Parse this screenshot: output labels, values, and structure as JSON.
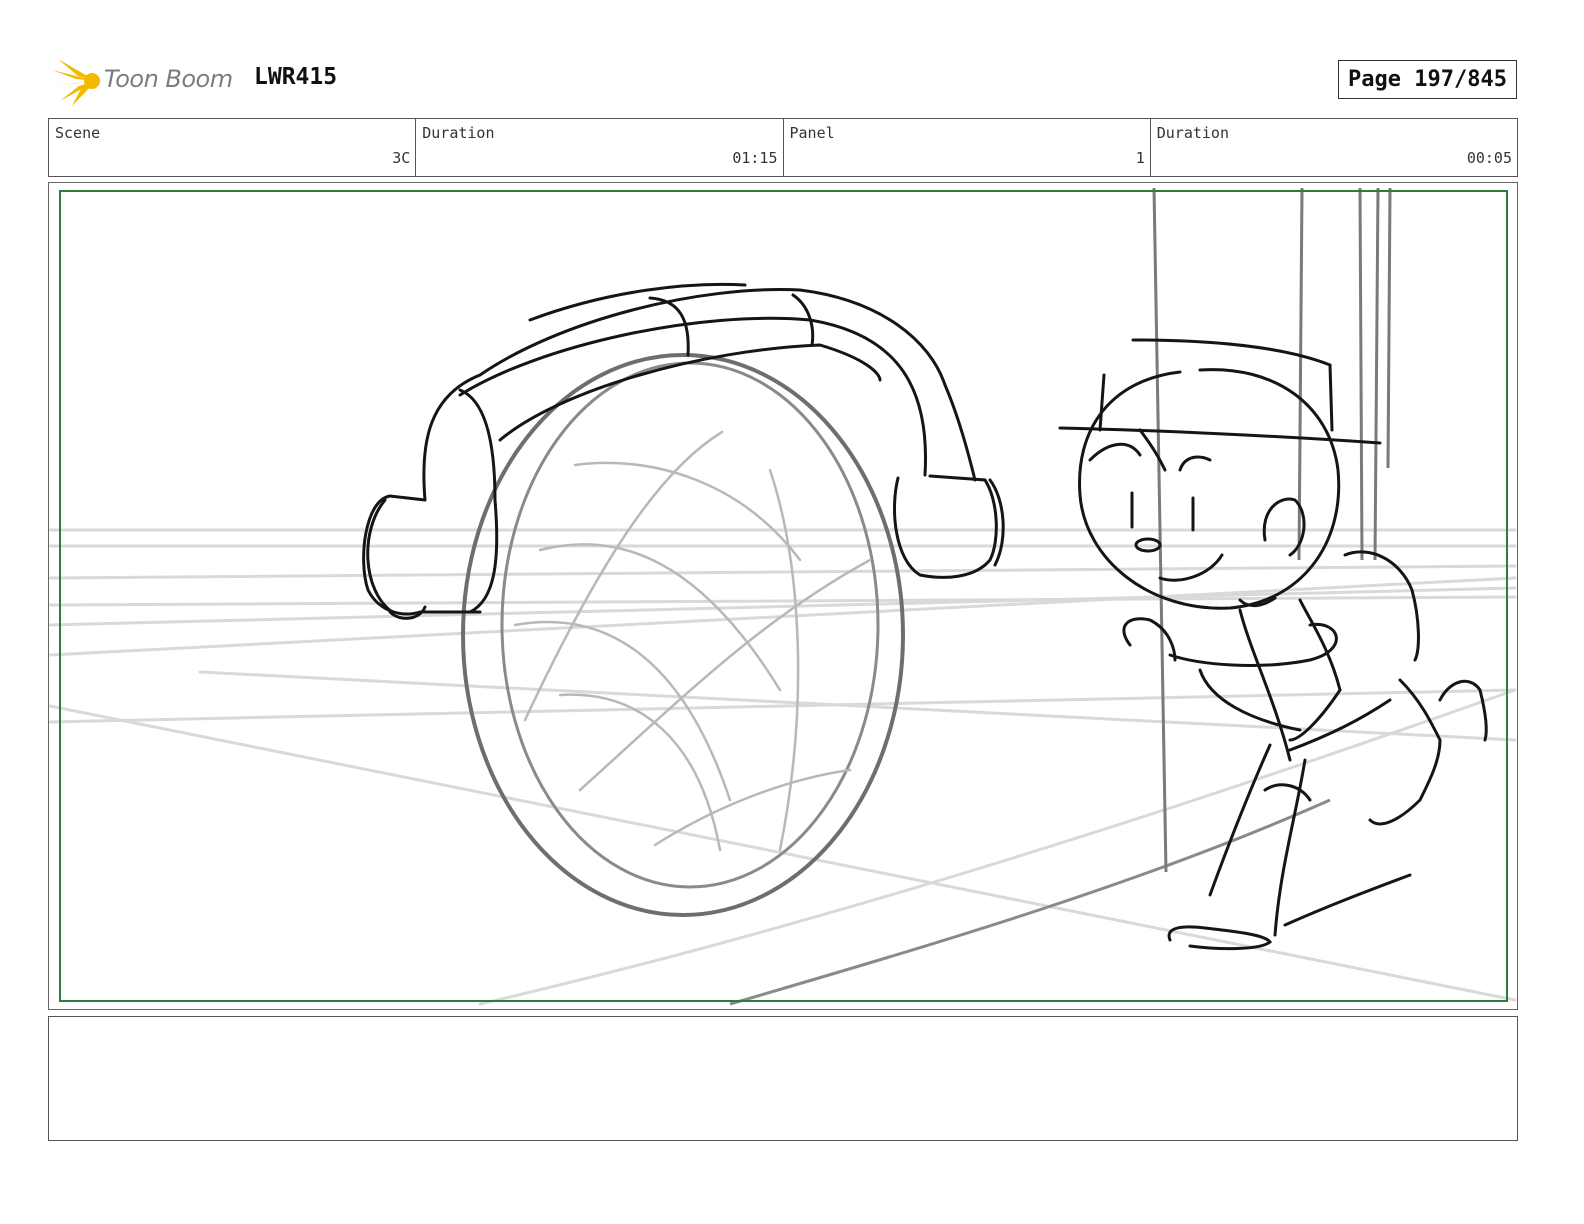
{
  "header": {
    "logo_text": "Toon Boom",
    "project_id": "LWR415",
    "page_label": "Page 197/845"
  },
  "info": {
    "scene_label": "Scene",
    "scene_value": "3C",
    "scene_duration_label": "Duration",
    "scene_duration_value": "01:15",
    "panel_label": "Panel",
    "panel_value": "1",
    "panel_duration_label": "Duration",
    "panel_duration_value": "00:05"
  },
  "notes": {
    "text": ""
  },
  "colors": {
    "safe_frame": "#2e7d32",
    "logo_yellow": "#f5b800"
  }
}
